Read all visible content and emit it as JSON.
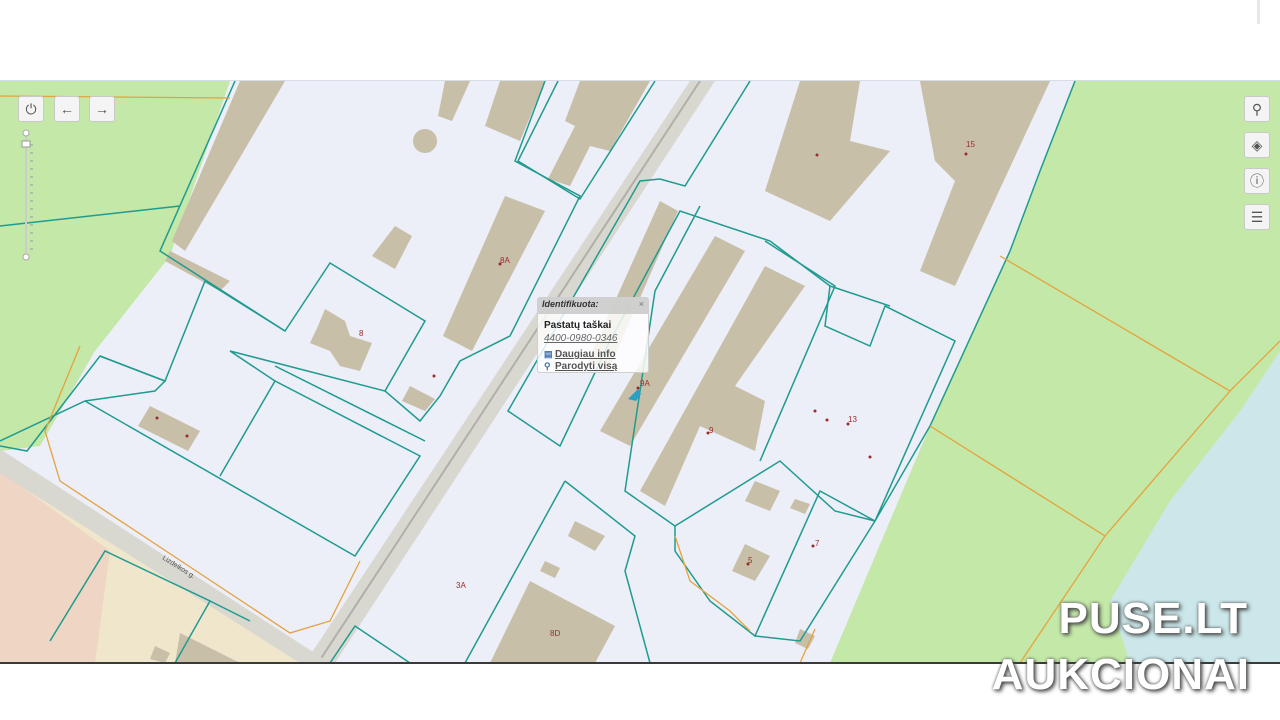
{
  "map": {
    "parcel_labels": [
      "15",
      "8A",
      "8",
      "13",
      "9",
      "3A",
      "5",
      "7",
      "8D",
      "2",
      "Lizdeikos g."
    ],
    "marker_label_near_popup": "9A",
    "colors": {
      "parcel_fill": "#eceef8",
      "building": "#c8bfa8",
      "boundary": "#1f9b8f",
      "forest": "#c3e8a8",
      "road": "#d6d6cf",
      "water": "#cbe7ea",
      "orange_line": "#e6a23c"
    }
  },
  "controls": {
    "power_icon": "power-icon",
    "back_icon": "arrow-left-icon",
    "forward_icon": "arrow-right-icon",
    "search_icon": "search-icon",
    "layers_icon": "layers-icon",
    "info_icon": "info-icon",
    "legend_icon": "document-icon"
  },
  "popup": {
    "header": "Identifikuota:",
    "close": "×",
    "title": "Pastatų taškai",
    "id": "4400-0980-0346",
    "link_more": "Daugiau info",
    "link_show_all": "Parodyti visą"
  },
  "watermark": {
    "line1": "PUSE.LT",
    "line2": "AUKCIONAI"
  }
}
